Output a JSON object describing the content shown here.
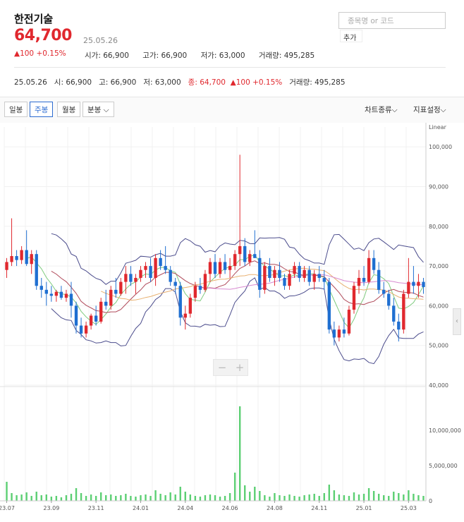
{
  "stock": {
    "name": "한전기술",
    "price": "64,700",
    "date": "25.05.26",
    "change": "▲100 +0.15%",
    "open": "시가: 66,900",
    "high": "고가: 66,900",
    "low": "저가: 63,000",
    "volume": "거래량: 495,285"
  },
  "search": {
    "placeholder": "종목명 or 코드",
    "add_label": "추가"
  },
  "summary": {
    "date": "25.05.26",
    "open": "시: 66,900",
    "high": "고: 66,900",
    "low": "저: 63,000",
    "close": "종: 64,700",
    "change": "▲100 +0.15%",
    "volume": "거래량: 495,285"
  },
  "toolbar": {
    "daily": "일봉",
    "weekly": "주봉",
    "monthly": "월봉",
    "minute": "분봉 ⌵",
    "chart_type": "차트종류⌵",
    "indicator": "지표설정⌵"
  },
  "side_handle": "‹",
  "zoom": {
    "minus": "−",
    "plus": "+"
  },
  "chart_data": {
    "type": "candlestick",
    "scale": "Linear",
    "price_ylim": [
      40000,
      105000
    ],
    "price_ticks": [
      "100,000",
      "90,000",
      "80,000",
      "70,000",
      "60,000",
      "50,000",
      "40,000"
    ],
    "price_tick_values": [
      100000,
      90000,
      80000,
      70000,
      60000,
      50000,
      40000
    ],
    "volume_ylim": [
      0,
      16000000
    ],
    "volume_ticks": [
      "10,000,000",
      "5,000,000",
      "0"
    ],
    "volume_tick_values": [
      10000000,
      5000000,
      0
    ],
    "x_ticks": [
      "23.07",
      "23.09",
      "23.11",
      "24.01",
      "24.04",
      "24.06",
      "24.08",
      "24.11",
      "25.01",
      "25.03"
    ],
    "x_tick_index": [
      0,
      9,
      18,
      27,
      36,
      45,
      54,
      63,
      72,
      81
    ],
    "candles": [
      [
        69000,
        72000,
        67000,
        71000,
        2700000
      ],
      [
        71000,
        82000,
        70000,
        72500,
        1100000
      ],
      [
        72500,
        74000,
        70000,
        71500,
        800000
      ],
      [
        71500,
        75000,
        70500,
        74000,
        900000
      ],
      [
        74000,
        79000,
        70000,
        70500,
        1200000
      ],
      [
        70500,
        74000,
        68000,
        73000,
        700000
      ],
      [
        73000,
        74000,
        64000,
        65000,
        1300000
      ],
      [
        65000,
        67000,
        62000,
        64000,
        800000
      ],
      [
        64000,
        66000,
        60000,
        63000,
        900000
      ],
      [
        63000,
        65000,
        61000,
        62500,
        600000
      ],
      [
        62500,
        64000,
        61000,
        63500,
        700000
      ],
      [
        63500,
        65000,
        61500,
        62000,
        500000
      ],
      [
        62000,
        64000,
        61000,
        63000,
        800000
      ],
      [
        63000,
        66000,
        57000,
        60000,
        1000000
      ],
      [
        60000,
        61000,
        53000,
        55000,
        1800000
      ],
      [
        55000,
        57000,
        52000,
        53000,
        1100000
      ],
      [
        53000,
        56000,
        52000,
        55000,
        700000
      ],
      [
        55000,
        58000,
        54000,
        57500,
        900000
      ],
      [
        57500,
        60000,
        55000,
        56000,
        700000
      ],
      [
        56000,
        62000,
        55500,
        61000,
        1200000
      ],
      [
        61000,
        64000,
        59000,
        60000,
        800000
      ],
      [
        60000,
        65000,
        59000,
        64000,
        900000
      ],
      [
        64000,
        67000,
        62000,
        63000,
        700000
      ],
      [
        63000,
        67000,
        62500,
        66000,
        800000
      ],
      [
        66000,
        70000,
        63000,
        68000,
        1000000
      ],
      [
        68000,
        70000,
        65000,
        66000,
        700000
      ],
      [
        66000,
        68000,
        63000,
        67000,
        600000
      ],
      [
        67000,
        70000,
        66000,
        69000,
        800000
      ],
      [
        69000,
        71000,
        67000,
        70000,
        900000
      ],
      [
        70000,
        72000,
        66000,
        67000,
        700000
      ],
      [
        67000,
        73000,
        65000,
        72000,
        1500000
      ],
      [
        72000,
        74000,
        69000,
        70000,
        1000000
      ],
      [
        70000,
        75000,
        68000,
        69000,
        800000
      ],
      [
        69000,
        70000,
        65000,
        66000,
        1200000
      ],
      [
        66000,
        67000,
        63000,
        65000,
        900000
      ],
      [
        65000,
        66000,
        55000,
        57000,
        2000000
      ],
      [
        57000,
        60000,
        54000,
        58000,
        1300000
      ],
      [
        58000,
        63000,
        57000,
        62000,
        900000
      ],
      [
        62000,
        66000,
        61000,
        65000,
        700000
      ],
      [
        65000,
        67000,
        63000,
        64000,
        600000
      ],
      [
        64000,
        69000,
        63500,
        68000,
        800000
      ],
      [
        68000,
        72000,
        66000,
        71000,
        900000
      ],
      [
        71000,
        73000,
        67000,
        68000,
        800000
      ],
      [
        68000,
        72000,
        67000,
        71000,
        600000
      ],
      [
        71000,
        73000,
        68000,
        69000,
        700000
      ],
      [
        69000,
        72000,
        67000,
        70000,
        1100000
      ],
      [
        70000,
        74000,
        69000,
        73000,
        4000000
      ],
      [
        73000,
        98000,
        70000,
        75000,
        13400000
      ],
      [
        75000,
        77000,
        70000,
        71000,
        2200000
      ],
      [
        71000,
        74000,
        70000,
        73000,
        1300000
      ],
      [
        73000,
        79000,
        72000,
        72000,
        2000000
      ],
      [
        72000,
        74000,
        62000,
        64000,
        1400000
      ],
      [
        64000,
        71000,
        63000,
        70000,
        800000
      ],
      [
        70000,
        72000,
        66000,
        67000,
        600000
      ],
      [
        67000,
        70000,
        65000,
        69000,
        1100000
      ],
      [
        69000,
        71000,
        66000,
        67000,
        800000
      ],
      [
        67000,
        68000,
        64000,
        65000,
        700000
      ],
      [
        65000,
        69000,
        64000,
        68000,
        900000
      ],
      [
        68000,
        71000,
        67000,
        70000,
        700000
      ],
      [
        70000,
        71000,
        66000,
        67000,
        600000
      ],
      [
        67000,
        70000,
        66000,
        69000,
        800000
      ],
      [
        69000,
        70000,
        65000,
        66000,
        900000
      ],
      [
        66000,
        69000,
        64000,
        68000,
        1000000
      ],
      [
        68000,
        70000,
        66000,
        67000,
        700000
      ],
      [
        67000,
        69000,
        64000,
        66000,
        1100000
      ],
      [
        66000,
        67000,
        53000,
        54000,
        2300000
      ],
      [
        54000,
        56000,
        50000,
        52000,
        1500000
      ],
      [
        52000,
        55000,
        51000,
        54000,
        900000
      ],
      [
        54000,
        57000,
        52000,
        53000,
        800000
      ],
      [
        53000,
        60000,
        52500,
        59000,
        700000
      ],
      [
        59000,
        66000,
        58000,
        65000,
        1200000
      ],
      [
        65000,
        69000,
        63000,
        67000,
        900000
      ],
      [
        67000,
        70000,
        65000,
        66000,
        1000000
      ],
      [
        66000,
        74000,
        65500,
        72000,
        1800000
      ],
      [
        72000,
        74000,
        68000,
        69000,
        1400000
      ],
      [
        69000,
        71000,
        63000,
        64000,
        1000000
      ],
      [
        64000,
        66000,
        62000,
        63000,
        800000
      ],
      [
        63000,
        64000,
        59000,
        60000,
        700000
      ],
      [
        60000,
        62000,
        55000,
        56000,
        1300000
      ],
      [
        56000,
        58000,
        51000,
        54000,
        1100000
      ],
      [
        54000,
        64000,
        53000,
        63000,
        900000
      ],
      [
        63000,
        72000,
        62000,
        66000,
        1500000
      ],
      [
        66000,
        70000,
        63000,
        65000,
        1000000
      ],
      [
        65000,
        68000,
        62000,
        66000,
        800000
      ],
      [
        66000,
        67000,
        63000,
        64700,
        700000
      ]
    ]
  }
}
